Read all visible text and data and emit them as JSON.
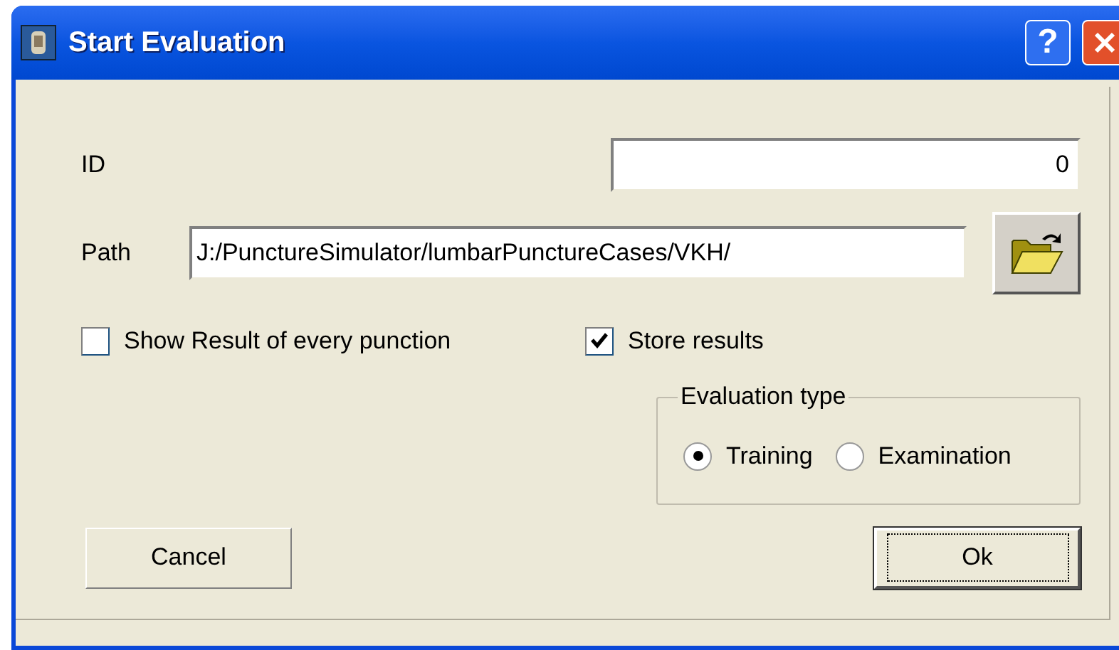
{
  "window": {
    "title": "Start Evaluation",
    "help_button": "?"
  },
  "id_field": {
    "label": "ID",
    "value": "0"
  },
  "path_field": {
    "label": "Path",
    "value": "J:/PunctureSimulator/lumbarPunctureCases/VKH/"
  },
  "checkboxes": [
    {
      "label": "Show Result of every punction",
      "checked": false
    },
    {
      "label": "Store results",
      "checked": true
    }
  ],
  "evaluation_type": {
    "title": "Evaluation type",
    "options": [
      {
        "label": "Training",
        "selected": true
      },
      {
        "label": "Examination",
        "selected": false
      }
    ]
  },
  "buttons": [
    {
      "label": "Cancel",
      "focused": false
    },
    {
      "label": "Ok",
      "focused": true
    }
  ]
}
